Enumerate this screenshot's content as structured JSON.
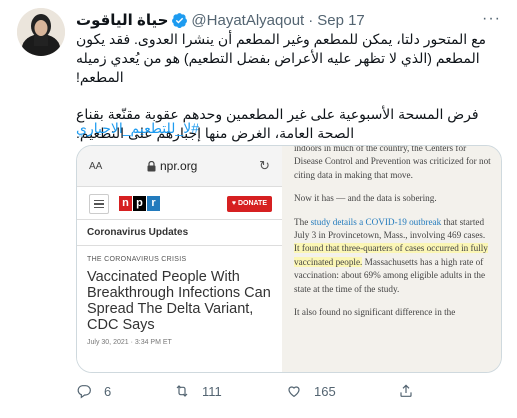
{
  "tweet": {
    "display_name": "حياة الياقوت",
    "handle": "@HayatAlyaqout",
    "separator": "·",
    "time": "Sep 17",
    "more_label": "···",
    "paragraph_1": "مع المتحور دلتا، يمكن للمطعم وغير المطعم أن ينشرا العدوى. فقد يكون المطعم (الذي لا تظهر عليه الأعراض بفضل التطعيم) هو من يُعدي زميله المطعم!",
    "paragraph_2": "فرض المسحة الأسبوعية على غير المطعمين وحدهم عقوبة مقنّعة بقناع الصحة العامة، الغرض منها إجبارهم على التطعيم.",
    "hashtag": "#لا_للتطعيم_الاجباري",
    "actions": {
      "replies": "6",
      "retweets": "111",
      "likes": "165"
    }
  },
  "media": {
    "phone": {
      "aa": "AA",
      "url": "npr.org",
      "logo": [
        "n",
        "p",
        "r"
      ],
      "donate": "♥ DONATE",
      "section": "Coronavirus Updates",
      "eyebrow": "THE CORONAVIRUS CRISIS",
      "headline": "Vaccinated People With Breakthrough Infections Can Spread The Delta Variant, CDC Says",
      "date": "July 30, 2021 · 3:34 PM ET"
    },
    "article": {
      "p1": "indoors in much of the country, the Centers for Disease Control and Prevention was criticized for not citing data in making that move.",
      "p2": "Now it has — and the data is sobering.",
      "p3_pre": "The ",
      "p3_link": "study details a COVID-19 outbreak",
      "p3_mid": " that started July 3 in Provincetown, Mass., involving 469 cases. ",
      "p3_highlight": "It found that three-quarters of cases occurred in fully vaccinated people.",
      "p3_post": " Massachusetts has a high rate of vaccination: about 69% among eligible adults in the state at the time of the study.",
      "p4": "It also found no significant difference in the"
    }
  },
  "colors": {
    "link": "#1d9bf0",
    "muted": "#536471",
    "npr_red": "#d62021",
    "npr_blue": "#237bbd",
    "highlight": "#fbf6b5"
  }
}
